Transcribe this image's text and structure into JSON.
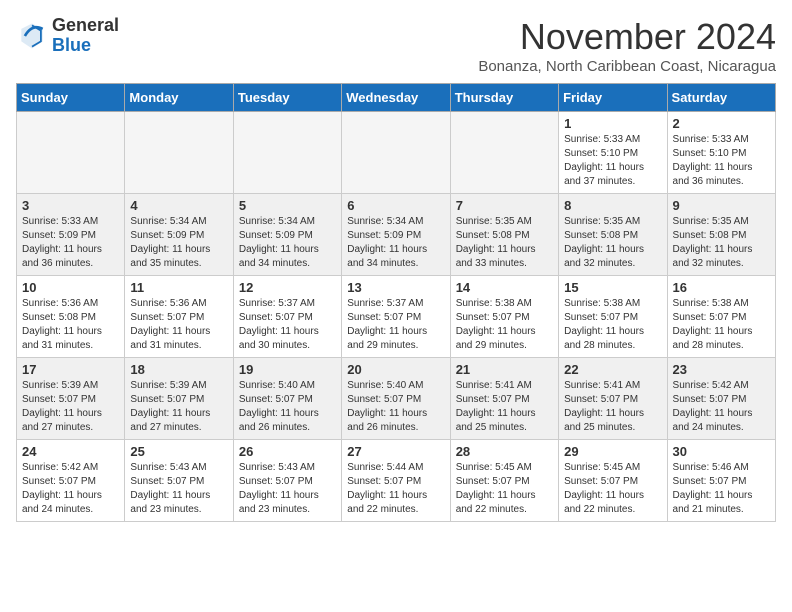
{
  "logo": {
    "general": "General",
    "blue": "Blue"
  },
  "header": {
    "month": "November 2024",
    "location": "Bonanza, North Caribbean Coast, Nicaragua"
  },
  "weekdays": [
    "Sunday",
    "Monday",
    "Tuesday",
    "Wednesday",
    "Thursday",
    "Friday",
    "Saturday"
  ],
  "weeks": [
    [
      {
        "day": "",
        "detail": ""
      },
      {
        "day": "",
        "detail": ""
      },
      {
        "day": "",
        "detail": ""
      },
      {
        "day": "",
        "detail": ""
      },
      {
        "day": "",
        "detail": ""
      },
      {
        "day": "1",
        "detail": "Sunrise: 5:33 AM\nSunset: 5:10 PM\nDaylight: 11 hours\nand 37 minutes."
      },
      {
        "day": "2",
        "detail": "Sunrise: 5:33 AM\nSunset: 5:10 PM\nDaylight: 11 hours\nand 36 minutes."
      }
    ],
    [
      {
        "day": "3",
        "detail": "Sunrise: 5:33 AM\nSunset: 5:09 PM\nDaylight: 11 hours\nand 36 minutes."
      },
      {
        "day": "4",
        "detail": "Sunrise: 5:34 AM\nSunset: 5:09 PM\nDaylight: 11 hours\nand 35 minutes."
      },
      {
        "day": "5",
        "detail": "Sunrise: 5:34 AM\nSunset: 5:09 PM\nDaylight: 11 hours\nand 34 minutes."
      },
      {
        "day": "6",
        "detail": "Sunrise: 5:34 AM\nSunset: 5:09 PM\nDaylight: 11 hours\nand 34 minutes."
      },
      {
        "day": "7",
        "detail": "Sunrise: 5:35 AM\nSunset: 5:08 PM\nDaylight: 11 hours\nand 33 minutes."
      },
      {
        "day": "8",
        "detail": "Sunrise: 5:35 AM\nSunset: 5:08 PM\nDaylight: 11 hours\nand 32 minutes."
      },
      {
        "day": "9",
        "detail": "Sunrise: 5:35 AM\nSunset: 5:08 PM\nDaylight: 11 hours\nand 32 minutes."
      }
    ],
    [
      {
        "day": "10",
        "detail": "Sunrise: 5:36 AM\nSunset: 5:08 PM\nDaylight: 11 hours\nand 31 minutes."
      },
      {
        "day": "11",
        "detail": "Sunrise: 5:36 AM\nSunset: 5:07 PM\nDaylight: 11 hours\nand 31 minutes."
      },
      {
        "day": "12",
        "detail": "Sunrise: 5:37 AM\nSunset: 5:07 PM\nDaylight: 11 hours\nand 30 minutes."
      },
      {
        "day": "13",
        "detail": "Sunrise: 5:37 AM\nSunset: 5:07 PM\nDaylight: 11 hours\nand 29 minutes."
      },
      {
        "day": "14",
        "detail": "Sunrise: 5:38 AM\nSunset: 5:07 PM\nDaylight: 11 hours\nand 29 minutes."
      },
      {
        "day": "15",
        "detail": "Sunrise: 5:38 AM\nSunset: 5:07 PM\nDaylight: 11 hours\nand 28 minutes."
      },
      {
        "day": "16",
        "detail": "Sunrise: 5:38 AM\nSunset: 5:07 PM\nDaylight: 11 hours\nand 28 minutes."
      }
    ],
    [
      {
        "day": "17",
        "detail": "Sunrise: 5:39 AM\nSunset: 5:07 PM\nDaylight: 11 hours\nand 27 minutes."
      },
      {
        "day": "18",
        "detail": "Sunrise: 5:39 AM\nSunset: 5:07 PM\nDaylight: 11 hours\nand 27 minutes."
      },
      {
        "day": "19",
        "detail": "Sunrise: 5:40 AM\nSunset: 5:07 PM\nDaylight: 11 hours\nand 26 minutes."
      },
      {
        "day": "20",
        "detail": "Sunrise: 5:40 AM\nSunset: 5:07 PM\nDaylight: 11 hours\nand 26 minutes."
      },
      {
        "day": "21",
        "detail": "Sunrise: 5:41 AM\nSunset: 5:07 PM\nDaylight: 11 hours\nand 25 minutes."
      },
      {
        "day": "22",
        "detail": "Sunrise: 5:41 AM\nSunset: 5:07 PM\nDaylight: 11 hours\nand 25 minutes."
      },
      {
        "day": "23",
        "detail": "Sunrise: 5:42 AM\nSunset: 5:07 PM\nDaylight: 11 hours\nand 24 minutes."
      }
    ],
    [
      {
        "day": "24",
        "detail": "Sunrise: 5:42 AM\nSunset: 5:07 PM\nDaylight: 11 hours\nand 24 minutes."
      },
      {
        "day": "25",
        "detail": "Sunrise: 5:43 AM\nSunset: 5:07 PM\nDaylight: 11 hours\nand 23 minutes."
      },
      {
        "day": "26",
        "detail": "Sunrise: 5:43 AM\nSunset: 5:07 PM\nDaylight: 11 hours\nand 23 minutes."
      },
      {
        "day": "27",
        "detail": "Sunrise: 5:44 AM\nSunset: 5:07 PM\nDaylight: 11 hours\nand 22 minutes."
      },
      {
        "day": "28",
        "detail": "Sunrise: 5:45 AM\nSunset: 5:07 PM\nDaylight: 11 hours\nand 22 minutes."
      },
      {
        "day": "29",
        "detail": "Sunrise: 5:45 AM\nSunset: 5:07 PM\nDaylight: 11 hours\nand 22 minutes."
      },
      {
        "day": "30",
        "detail": "Sunrise: 5:46 AM\nSunset: 5:07 PM\nDaylight: 11 hours\nand 21 minutes."
      }
    ]
  ]
}
